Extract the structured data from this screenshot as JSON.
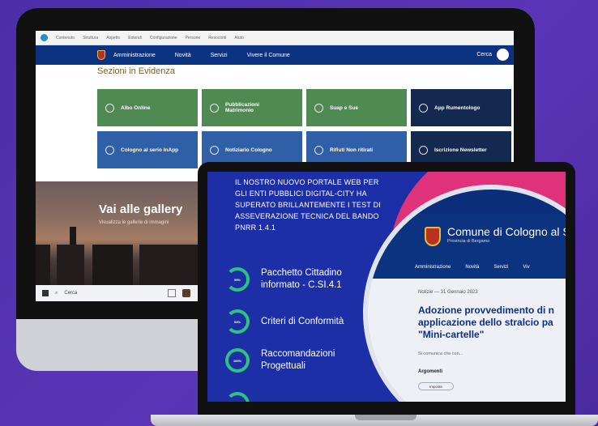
{
  "desktop": {
    "admin_bar": [
      "Contenuto",
      "Struttura",
      "Aspetto",
      "Estendi",
      "Configurazione",
      "Persone",
      "Resoconti",
      "Aiuto"
    ],
    "nav": {
      "items": [
        "Amministrazione",
        "Novità",
        "Servizi",
        "Vivere il Comune"
      ],
      "search_label": "Cerca"
    },
    "section_title": "Sezioni in Evidenza",
    "tiles": [
      {
        "label": "Albo Online",
        "color": "#4e8a52"
      },
      {
        "label": "Pubblicazioni Matrimonio",
        "color": "#4e8a52"
      },
      {
        "label": "Suap e Sue",
        "color": "#4e8a52"
      },
      {
        "label": "App Rumentologo",
        "color": "#13294f"
      },
      {
        "label": "Cologno al serio InApp",
        "color": "#2f5fa6"
      },
      {
        "label": "Notiziario Cologno",
        "color": "#2f5fa6"
      },
      {
        "label": "Rifiuti Non ritirati",
        "color": "#2f5fa6"
      },
      {
        "label": "Iscrizione Newsletter",
        "color": "#13294f"
      }
    ],
    "gallery": {
      "title": "Vai alle gallery",
      "subtitle": "Visualizza le gallerie di immagini"
    },
    "taskbar": {
      "search_placeholder": "Cerca"
    }
  },
  "laptop": {
    "intro_text": "IL NOSTRO NUOVO PORTALE WEB PER GLI ENTI PUBBLICI DIGITAL-CITY HA SUPERATO BRILLANTEMENTE I TEST DI ASSEVERAZIONE TECNICA DEL BANDO PNRR 1.4.1",
    "criteria": [
      {
        "label": "Pacchetto Cittadino informato - C.SI.4.1",
        "percent": "99%"
      },
      {
        "label": "Criteri di Conformità",
        "percent": "94%"
      },
      {
        "label": "Raccomandazioni Progettuali",
        "percent": "100%"
      }
    ],
    "site": {
      "title": "Comune di Cologno al S",
      "subtitle": "Provincia di Bergamo",
      "nav": [
        "Amministrazione",
        "Novità",
        "Servizi",
        "Viv"
      ],
      "meta": "Notizie — 31 Gennaio 2023",
      "headline_lines": [
        "Adozione provvedimento di n",
        "applicazione dello stralcio pa",
        "\"Mini-cartelle\""
      ],
      "description": "Si comunica che con...",
      "arguments_label": "Argomenti",
      "tag": "Imposte"
    }
  },
  "colors": {
    "background": "#4a2fa8",
    "nav_blue": "#0b3380",
    "ring_green": "#2ec27e",
    "accent_pink": "#e0327a"
  }
}
